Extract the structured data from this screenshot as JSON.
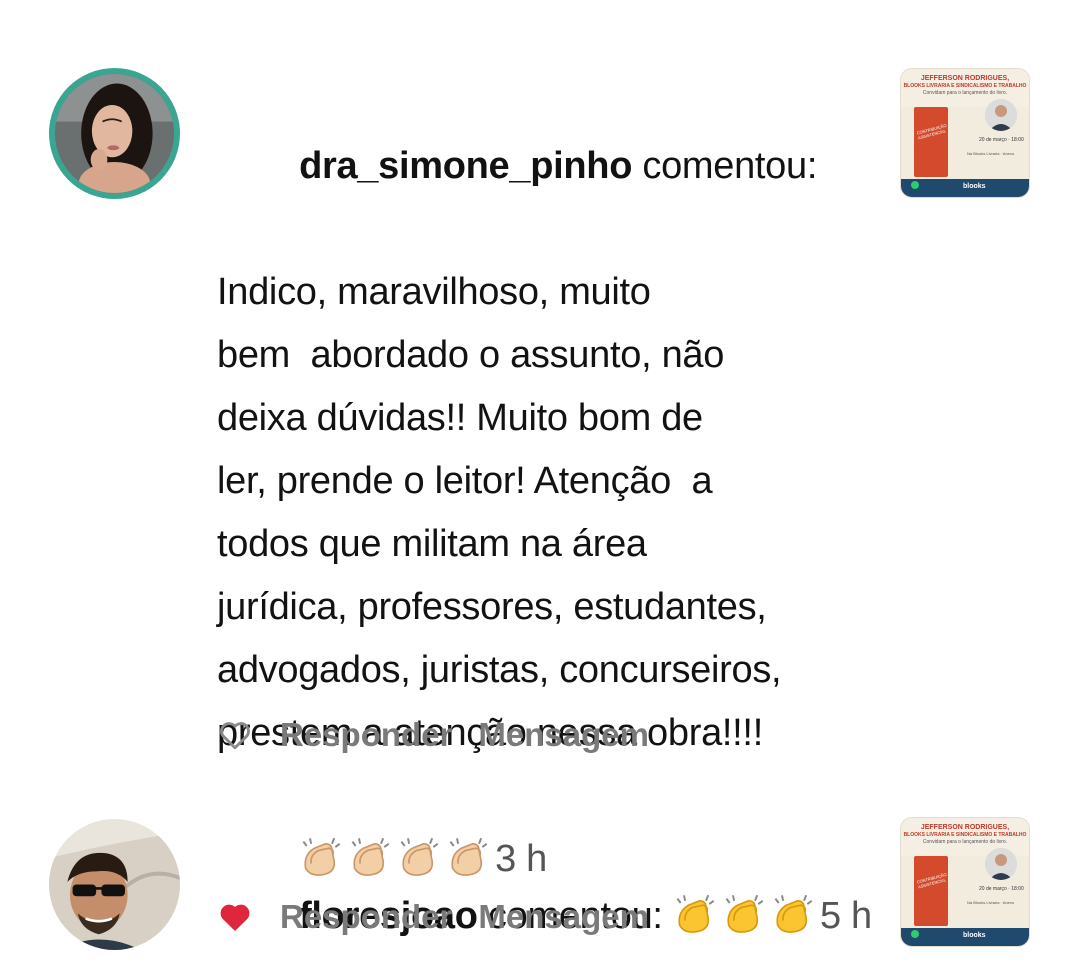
{
  "comments": [
    {
      "username": "dra_simone_pinho",
      "action_text": " comentou:",
      "body_lines": [
        "Indico, maravilhoso, muito",
        "bem  abordado o assunto, não",
        "deixa dúvidas!! Muito bom de",
        "ler, prende o leitor! Atenção  a",
        "todos que militam na área",
        "jurídica, professores, estudantes,",
        "advogados, juristas, concurseiros,",
        "prestem a atenção nessa obra!!!!"
      ],
      "emoji": [
        "clapping-hands-light",
        "clapping-hands-light",
        "clapping-hands-light",
        "clapping-hands-light"
      ],
      "time": "3 h",
      "liked": false,
      "reply_label": "Responder",
      "message_label": "Mensagem"
    },
    {
      "username": "floresjoao",
      "action_text": " comentou: ",
      "emoji": [
        "clapping-hands-yellow",
        "clapping-hands-yellow",
        "clapping-hands-yellow"
      ],
      "time": "5 h",
      "liked": true,
      "reply_label": "Responder",
      "message_label": "Mensagem"
    }
  ],
  "post_thumbnail": {
    "title": "JEFFERSON RODRIGUES,",
    "subtitle": "BLOOKS LIVRARIA E SINDICALISMO E TRABALHO",
    "invite": "Convidam para o lançamento do livro.",
    "book_label": "CONTRIBUIÇÃO ASSISTENCIAL",
    "date": "20 de março · 18:00",
    "place": "Na Blooks Livraria · Anexo",
    "brand": "blooks"
  },
  "colors": {
    "heart_liked": "#e0263d",
    "action_gray": "#7a7a7a",
    "avatar_ring": "#3aa692"
  }
}
